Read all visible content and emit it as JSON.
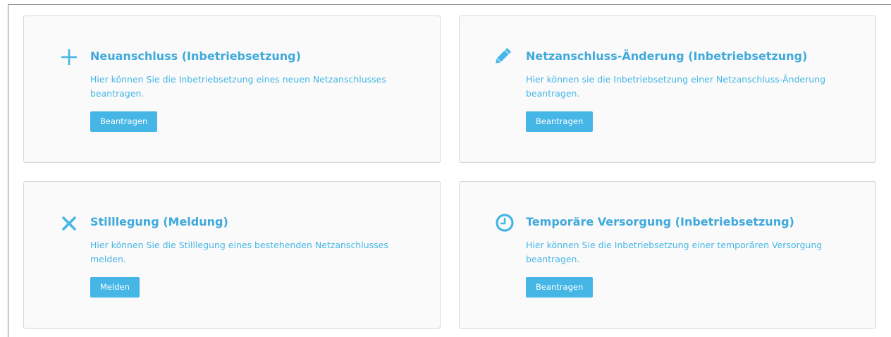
{
  "cards": [
    {
      "icon": "plus-icon",
      "title": "Neuanschluss (Inbetriebsetzung)",
      "description": "Hier können Sie die Inbetriebsetzung eines neuen Netzanschlusses beantragen.",
      "button": "Beantragen"
    },
    {
      "icon": "pencil-icon",
      "title": "Netzanschluss-Änderung (Inbetriebsetzung)",
      "description": "Hier können sie die Inbetriebsetzung einer Netzanschluss-Änderung beantragen.",
      "button": "Beantragen"
    },
    {
      "icon": "close-icon",
      "title": "Stilllegung (Meldung)",
      "description": "Hier können Sie die Stilllegung eines bestehenden Netzanschlusses melden.",
      "button": "Melden"
    },
    {
      "icon": "clock-icon",
      "title": "Temporäre Versorgung (Inbetriebsetzung)",
      "description": "Hier können Sie die Inbetriebsetzung einer temporären Versorgung beantragen.",
      "button": "Beantragen"
    }
  ],
  "colors": {
    "accent": "#45b6e6",
    "title": "#3fa9db",
    "card_background": "#fafafa",
    "card_border": "#d6d6d6"
  }
}
